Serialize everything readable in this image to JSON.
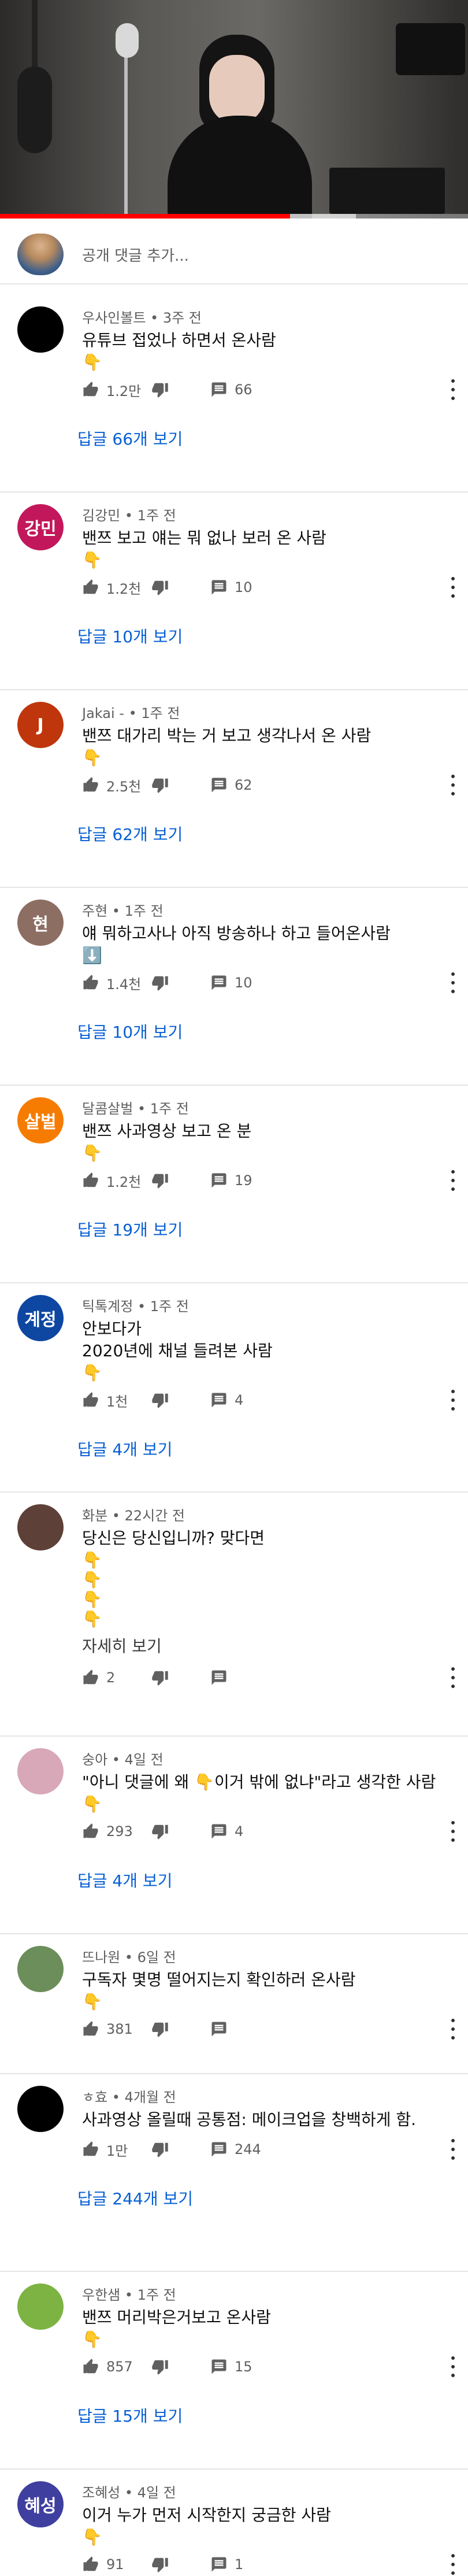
{
  "video": {
    "progress_percent": 62,
    "buffer_percent": 14
  },
  "add_comment": {
    "placeholder": "공개 댓글 추가..."
  },
  "comments": [
    {
      "author": "우사인볼트",
      "time": "3주 전",
      "text": "유튜브 접었나 하면서 온사람",
      "emoji": [
        "👇"
      ],
      "likes": "1.2만",
      "replies": "66",
      "replies_link": "답글 66개 보기",
      "avatar_text": "",
      "avatar_color": "#000000"
    },
    {
      "author": "김강민",
      "time": "1주 전",
      "text": "밴쯔 보고 얘는 뭐 없나 보러 온 사람",
      "emoji": [
        "👇"
      ],
      "likes": "1.2천",
      "replies": "10",
      "replies_link": "답글 10개 보기",
      "avatar_text": "강민",
      "avatar_color": "#c2185b"
    },
    {
      "author": "Jakai -",
      "time": "1주 전",
      "text": "밴쯔 대가리 박는 거 보고 생각나서 온 사람",
      "emoji": [
        "👇"
      ],
      "likes": "2.5천",
      "replies": "62",
      "replies_link": "답글 62개 보기",
      "avatar_text": "J",
      "avatar_color": "#bf360c"
    },
    {
      "author": "주현",
      "time": "1주 전",
      "text": "얘 뭐하고사나 아직 방송하나 하고 들어온사람",
      "emoji": [
        "⬇️"
      ],
      "likes": "1.4천",
      "replies": "10",
      "replies_link": "답글 10개 보기",
      "avatar_text": "현",
      "avatar_color": "#8d6e63"
    },
    {
      "author": "달콤살벌",
      "time": "1주 전",
      "text": "밴쯔 사과영상 보고 온 분",
      "emoji": [
        "👇"
      ],
      "likes": "1.2천",
      "replies": "19",
      "replies_link": "답글 19개 보기",
      "avatar_text": "살벌",
      "avatar_color": "#f57c00"
    },
    {
      "author": "틱톡계정",
      "time": "1주 전",
      "text": "안보다가\n2020년에 채널 들려본 사람",
      "emoji": [
        "👇"
      ],
      "likes": "1천",
      "replies": "4",
      "replies_link": "답글 4개 보기",
      "avatar_text": "계정",
      "avatar_color": "#0d47a1"
    },
    {
      "author": "화분",
      "time": "22시간 전",
      "text": "당신은 당신입니까? 맞다면",
      "emoji": [
        "👇",
        "👇",
        "👇",
        "👇"
      ],
      "more_label": "자세히 보기",
      "likes": "2",
      "replies": "",
      "replies_link": "",
      "avatar_text": "",
      "avatar_color": "#5d4037"
    },
    {
      "author": "숭아",
      "time": "4일 전",
      "text": "\"아니 댓글에 왜 👇이거 밖에 없냐\"라고 생각한 사람",
      "emoji": [
        "👇"
      ],
      "likes": "293",
      "replies": "4",
      "replies_link": "답글 4개 보기",
      "avatar_text": "",
      "avatar_color": "#d8a7b8"
    },
    {
      "author": "뜨나원",
      "time": "6일 전",
      "text": "구독자 몇명 떨어지는지 확인하러 온사람",
      "emoji": [
        "👇"
      ],
      "likes": "381",
      "replies": "",
      "replies_link": "",
      "avatar_text": "",
      "avatar_color": "#6b8e5a"
    },
    {
      "author": "ㅎ효",
      "time": "4개월 전",
      "text": "사과영상 올릴때 공통점: 메이크업을 창백하게 함.",
      "emoji": [],
      "likes": "1만",
      "replies": "244",
      "replies_link": "답글 244개 보기",
      "avatar_text": "",
      "avatar_color": "#000000"
    },
    {
      "author": "우한샘",
      "time": "1주 전",
      "text": "밴쯔 머리박은거보고 온사람",
      "emoji": [
        "👇"
      ],
      "likes": "857",
      "replies": "15",
      "replies_link": "답글 15개 보기",
      "avatar_text": "",
      "avatar_color": "#7cb342"
    },
    {
      "author": "조혜성",
      "time": "4일 전",
      "text": "이거 누가 먼저 시작한지 궁금한 사람",
      "emoji": [
        "👇"
      ],
      "likes": "91",
      "replies": "1",
      "replies_link": "",
      "avatar_text": "혜성",
      "avatar_color": "#3f3fa0"
    }
  ]
}
